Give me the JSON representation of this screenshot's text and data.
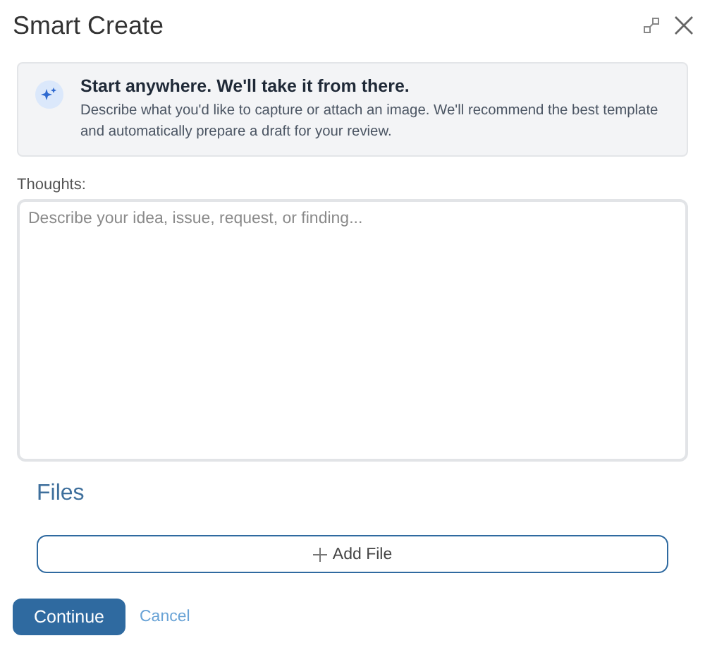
{
  "window": {
    "title": "Smart Create"
  },
  "info": {
    "heading": "Start anywhere. We'll take it from there.",
    "text": "Describe what you'd like to capture or attach an image. We'll recommend the best template and automatically prepare a draft for your review."
  },
  "thoughts": {
    "label": "Thoughts:",
    "placeholder": "Describe your idea, issue, request, or finding..."
  },
  "files": {
    "heading": "Files",
    "add_button": "Add File"
  },
  "buttons": {
    "primary": "Continue",
    "secondary": "Cancel"
  }
}
